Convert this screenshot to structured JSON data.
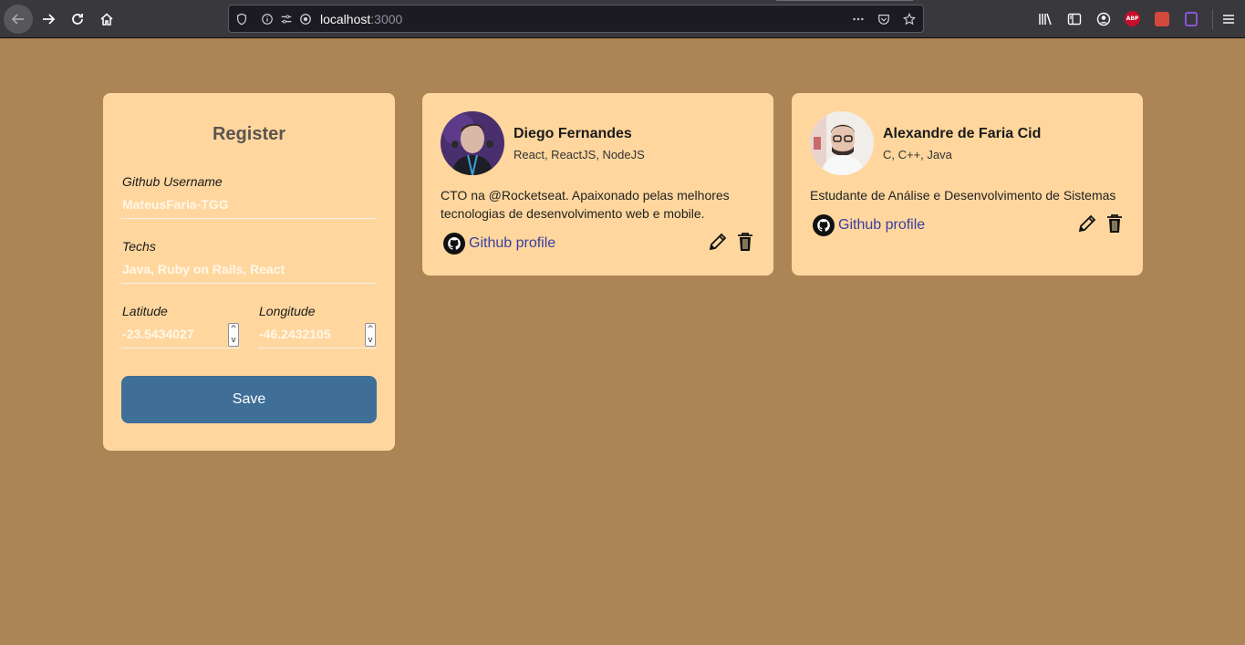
{
  "browser": {
    "url_host": "localhost",
    "url_port": ":3000"
  },
  "register": {
    "title": "Register",
    "github_label": "Github Username",
    "github_value": "MateusFaria-TGG",
    "techs_label": "Techs",
    "techs_value": "Java, Ruby on Rails, React",
    "latitude_label": "Latitude",
    "latitude_value": "-23.5434027",
    "longitude_label": "Longitude",
    "longitude_value": "-46.2432105",
    "save_label": "Save"
  },
  "devs": [
    {
      "name": "Diego Fernandes",
      "techs": "React, ReactJS, NodeJS",
      "bio": "CTO na @Rocketseat. Apaixonado pelas melhores tecnologias de desenvolvimento web e mobile.",
      "link_label": "Github profile"
    },
    {
      "name": "Alexandre de Faria Cid",
      "techs": "C, C++, Java",
      "bio": "Estudante de Análise e Desenvolvimento de Sistemas",
      "link_label": "Github profile"
    }
  ],
  "colors": {
    "page_bg": "#ab8555",
    "card_bg": "#ffd79e",
    "button_bg": "#3f6f97",
    "link": "#3a3da0"
  },
  "icons": [
    "back-icon",
    "forward-icon",
    "reload-icon",
    "home-icon",
    "shield-icon",
    "info-icon",
    "permissions-icon",
    "site-icon",
    "more-icon",
    "pocket-icon",
    "bookmark-star-icon",
    "library-icon",
    "sidebar-icon",
    "account-icon",
    "adblock-icon",
    "extension-icon",
    "menu-icon",
    "github-icon",
    "pencil-icon",
    "trash-icon"
  ]
}
